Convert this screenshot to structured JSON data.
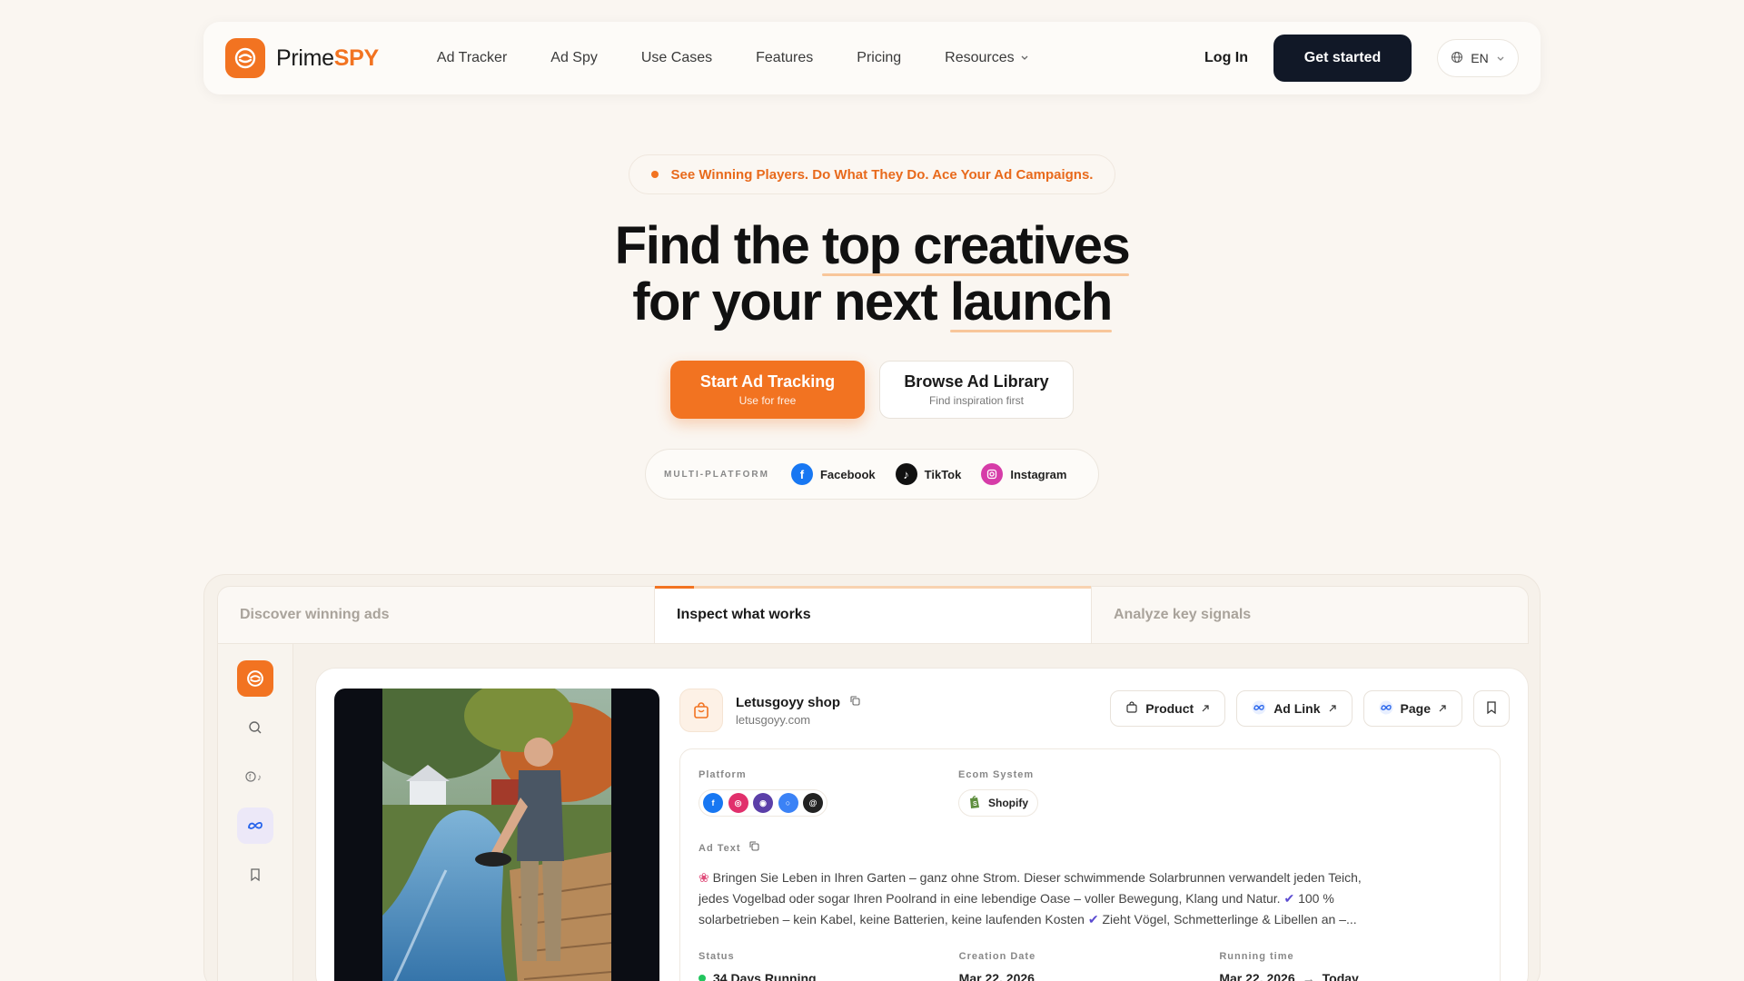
{
  "brand": {
    "name_prefix": "Prime",
    "name_suffix": "SPY",
    "accent": "#f27321"
  },
  "nav": {
    "links": [
      "Ad Tracker",
      "Ad Spy",
      "Use Cases",
      "Features",
      "Pricing",
      "Resources"
    ],
    "login": "Log In",
    "cta": "Get started",
    "language": "EN"
  },
  "announcement": "See Winning Players. Do What They Do. Ace Your Ad Campaigns.",
  "hero": {
    "line1_pre": "Find the ",
    "line1_hl": "top creatives",
    "line2_pre": "for your next ",
    "line2_hl": "launch"
  },
  "cta": {
    "primary_title": "Start Ad Tracking",
    "primary_sub": "Use for free",
    "secondary_title": "Browse Ad Library",
    "secondary_sub": "Find inspiration first"
  },
  "platforms": {
    "label": "MULTI-PLATFORM",
    "items": [
      {
        "name": "Facebook",
        "icon": "facebook-icon",
        "color": "#1877f2"
      },
      {
        "name": "TikTok",
        "icon": "tiktok-icon",
        "color": "#111111"
      },
      {
        "name": "Instagram",
        "icon": "instagram-icon",
        "color": "#d63ca8"
      }
    ]
  },
  "showcase": {
    "tabs": [
      "Discover winning ads",
      "Inspect what works",
      "Analyze key signals"
    ],
    "active_tab": 1,
    "ad": {
      "shop_name": "Letusgoyy shop",
      "shop_domain": "letusgoyy.com",
      "actions": [
        "Product",
        "Ad Link",
        "Page"
      ],
      "platform_label": "Platform",
      "ecom_label": "Ecom System",
      "ecom_value": "Shopify",
      "ad_text_label": "Ad Text",
      "ad_text_line1": "Bringen Sie Leben in Ihren Garten – ganz ohne Strom. Dieser schwimmende Solarbrunnen verwandelt jeden Teich,",
      "ad_text_line2_a": "jedes Vogelbad oder sogar Ihren Poolrand in eine lebendige Oase – voller Bewegung, Klang und Natur.",
      "ad_text_line2_b": "100 %",
      "ad_text_line3_a": "solarbetrieben – kein Kabel, keine Batterien, keine laufenden Kosten",
      "ad_text_line3_b": "Zieht Vögel, Schmetterlinge & Libellen an –...",
      "status_label": "Status",
      "status_value": "34 Days Running",
      "creation_label": "Creation Date",
      "creation_value": "Mar 22, 2026",
      "running_label": "Running time",
      "running_from": "Mar 22, 2026",
      "running_to": "Today"
    }
  }
}
